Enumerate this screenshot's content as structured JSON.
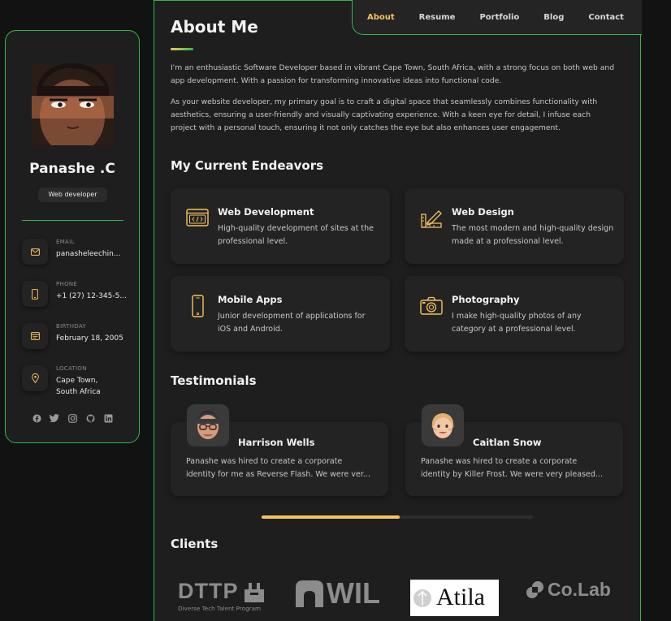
{
  "profile": {
    "name": "Panashe .C",
    "title": "Web developer",
    "contacts": [
      {
        "label": "EMAIL",
        "value": "panasheleechin...",
        "icon": "mail-icon"
      },
      {
        "label": "PHONE",
        "value": "+1 (27) 12-345-5...",
        "icon": "phone-icon"
      },
      {
        "label": "BIRTHDAY",
        "value": "February 18, 2005",
        "icon": "calendar-icon"
      },
      {
        "label": "LOCATION",
        "value": "Cape Town, South Africa",
        "icon": "location-pin-icon"
      }
    ],
    "socials": [
      "facebook-icon",
      "twitter-icon",
      "instagram-icon",
      "github-icon",
      "linkedin-icon"
    ]
  },
  "nav": {
    "items": [
      "About",
      "Resume",
      "Portfolio",
      "Blog",
      "Contact"
    ],
    "active": "About"
  },
  "about": {
    "heading": "About Me",
    "paragraphs": [
      "I'm an enthusiastic Software Developer based in vibrant Cape Town, South Africa, with a strong focus on both web and app development. With a passion for transforming innovative ideas into functional code.",
      "As your website developer, my primary goal is to craft a digital space that seamlessly combines functionality with aesthetics, ensuring a user-friendly and visually captivating experience. With a keen eye for detail, I infuse each project with a personal touch, ensuring it not only catches the eye but also enhances user engagement."
    ]
  },
  "endeavors": {
    "heading": "My Current Endeavors",
    "items": [
      {
        "title": "Web Development",
        "text": "High-quality development of sites at the professional level.",
        "icon": "code-window-icon"
      },
      {
        "title": "Web Design",
        "text": "The most modern and high-quality design made at a professional level.",
        "icon": "design-pencil-icon"
      },
      {
        "title": "Mobile Apps",
        "text": "Junior development of applications for iOS and Android.",
        "icon": "smartphone-icon"
      },
      {
        "title": "Photography",
        "text": "I make high-quality photos of any category at a professional level.",
        "icon": "camera-icon"
      }
    ]
  },
  "testimonials": {
    "heading": "Testimonials",
    "items": [
      {
        "name": "Harrison Wells",
        "line1": "Panashe was hired to create a corporate",
        "line2": "identity for me as Reverse Flash. We were ver..."
      },
      {
        "name": "Caitlan Snow",
        "line1": "Panashe was hired to create a corporate",
        "line2": "identity by Killer Frost. We were very pleased..."
      }
    ],
    "scroll_progress": 0.51
  },
  "clients": {
    "heading": "Clients",
    "logos": [
      {
        "name": "DTTP",
        "tagline": "Diverse Tech Talent Program"
      },
      {
        "name": "WIL"
      },
      {
        "name": "Atila"
      },
      {
        "name": "Co.Lab"
      }
    ]
  },
  "colors": {
    "accent": "#f5c45e",
    "border": "#2fb84a",
    "bg": "#121212",
    "panel": "#1e1e1f"
  }
}
